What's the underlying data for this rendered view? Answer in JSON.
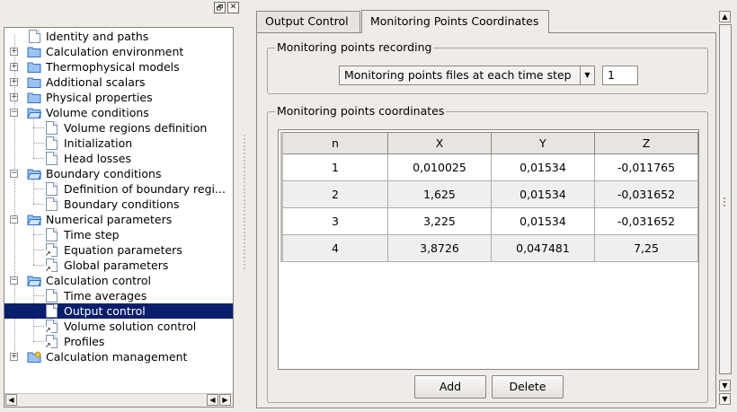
{
  "window": {
    "float_button": "🗗",
    "close_button": "✕"
  },
  "tree": {
    "items": [
      {
        "label": "Identity and paths",
        "kind": "page",
        "depth": 0
      },
      {
        "label": "Calculation environment",
        "kind": "folder",
        "depth": 0,
        "expander": "+"
      },
      {
        "label": "Thermophysical models",
        "kind": "folder",
        "depth": 0,
        "expander": "+"
      },
      {
        "label": "Additional scalars",
        "kind": "folder",
        "depth": 0,
        "expander": "+"
      },
      {
        "label": "Physical properties",
        "kind": "folder",
        "depth": 0,
        "expander": "+"
      },
      {
        "label": "Volume conditions",
        "kind": "folder-open",
        "depth": 0,
        "expander": "−"
      },
      {
        "label": "Volume regions definition",
        "kind": "page",
        "depth": 1
      },
      {
        "label": "Initialization",
        "kind": "page",
        "depth": 1
      },
      {
        "label": "Head losses",
        "kind": "page",
        "depth": 1
      },
      {
        "label": "Boundary conditions",
        "kind": "folder-open",
        "depth": 0,
        "expander": "−"
      },
      {
        "label": "Definition of boundary regi...",
        "kind": "page",
        "depth": 1
      },
      {
        "label": "Boundary conditions",
        "kind": "page",
        "depth": 1
      },
      {
        "label": "Numerical parameters",
        "kind": "folder-open",
        "depth": 0,
        "expander": "−"
      },
      {
        "label": "Time step",
        "kind": "page",
        "depth": 1
      },
      {
        "label": "Equation parameters",
        "kind": "page-link",
        "depth": 1
      },
      {
        "label": "Global parameters",
        "kind": "page-link",
        "depth": 1
      },
      {
        "label": "Calculation control",
        "kind": "folder-open",
        "depth": 0,
        "expander": "−"
      },
      {
        "label": "Time averages",
        "kind": "page",
        "depth": 1
      },
      {
        "label": "Output control",
        "kind": "page",
        "depth": 1,
        "selected": true
      },
      {
        "label": "Volume solution control",
        "kind": "page-link",
        "depth": 1
      },
      {
        "label": "Profiles",
        "kind": "page-link",
        "depth": 1
      },
      {
        "label": "Calculation management",
        "kind": "folder-run",
        "depth": 0,
        "expander": "+"
      }
    ],
    "scroll_left": "◀",
    "scroll_left2": "◀",
    "scroll_right": "▶"
  },
  "tabs": [
    {
      "label": "Output Control",
      "active": false
    },
    {
      "label": "Monitoring Points Coordinates",
      "active": true
    }
  ],
  "recording": {
    "title": "Monitoring points recording",
    "frequency_selected": "Monitoring points files at each time step",
    "frequency_arrow": "▼",
    "interval_value": "1"
  },
  "coordinates": {
    "title": "Monitoring points coordinates",
    "columns": [
      "n",
      "X",
      "Y",
      "Z"
    ],
    "rows": [
      [
        "1",
        "0,010025",
        "0,01534",
        "-0,011765"
      ],
      [
        "2",
        "1,625",
        "0,01534",
        "-0,031652"
      ],
      [
        "3",
        "3,225",
        "0,01534",
        "-0,031652"
      ],
      [
        "4",
        "3,8726",
        "0,047481",
        "7,25"
      ]
    ],
    "add_label": "Add",
    "delete_label": "Delete"
  },
  "scrollbar": {
    "up": "▲",
    "down": "▼",
    "down2": "▼"
  },
  "colors": {
    "selection": "#0a1f6c",
    "folder": "#2f6fd0"
  }
}
